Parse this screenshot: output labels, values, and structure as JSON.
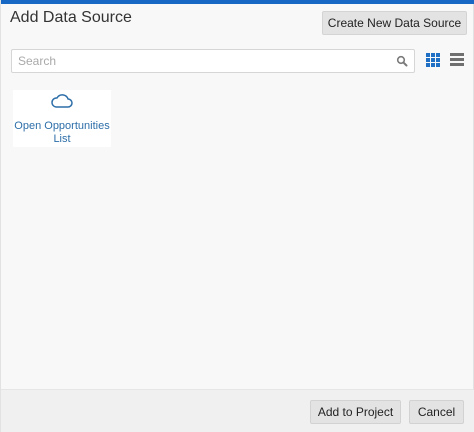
{
  "dialog": {
    "title": "Add Data Source",
    "accent_color": "#1767c4",
    "create_button_label": "Create New Data Source"
  },
  "search": {
    "placeholder": "Search",
    "icon": "search-icon"
  },
  "view_toggles": [
    {
      "name": "grid-view-icon",
      "active": true
    },
    {
      "name": "list-view-icon",
      "active": false
    }
  ],
  "data_sources": [
    {
      "label": "Open Opportunities List",
      "icon": "cloud-icon"
    }
  ],
  "footer": {
    "add_label": "Add to Project",
    "cancel_label": "Cancel"
  }
}
